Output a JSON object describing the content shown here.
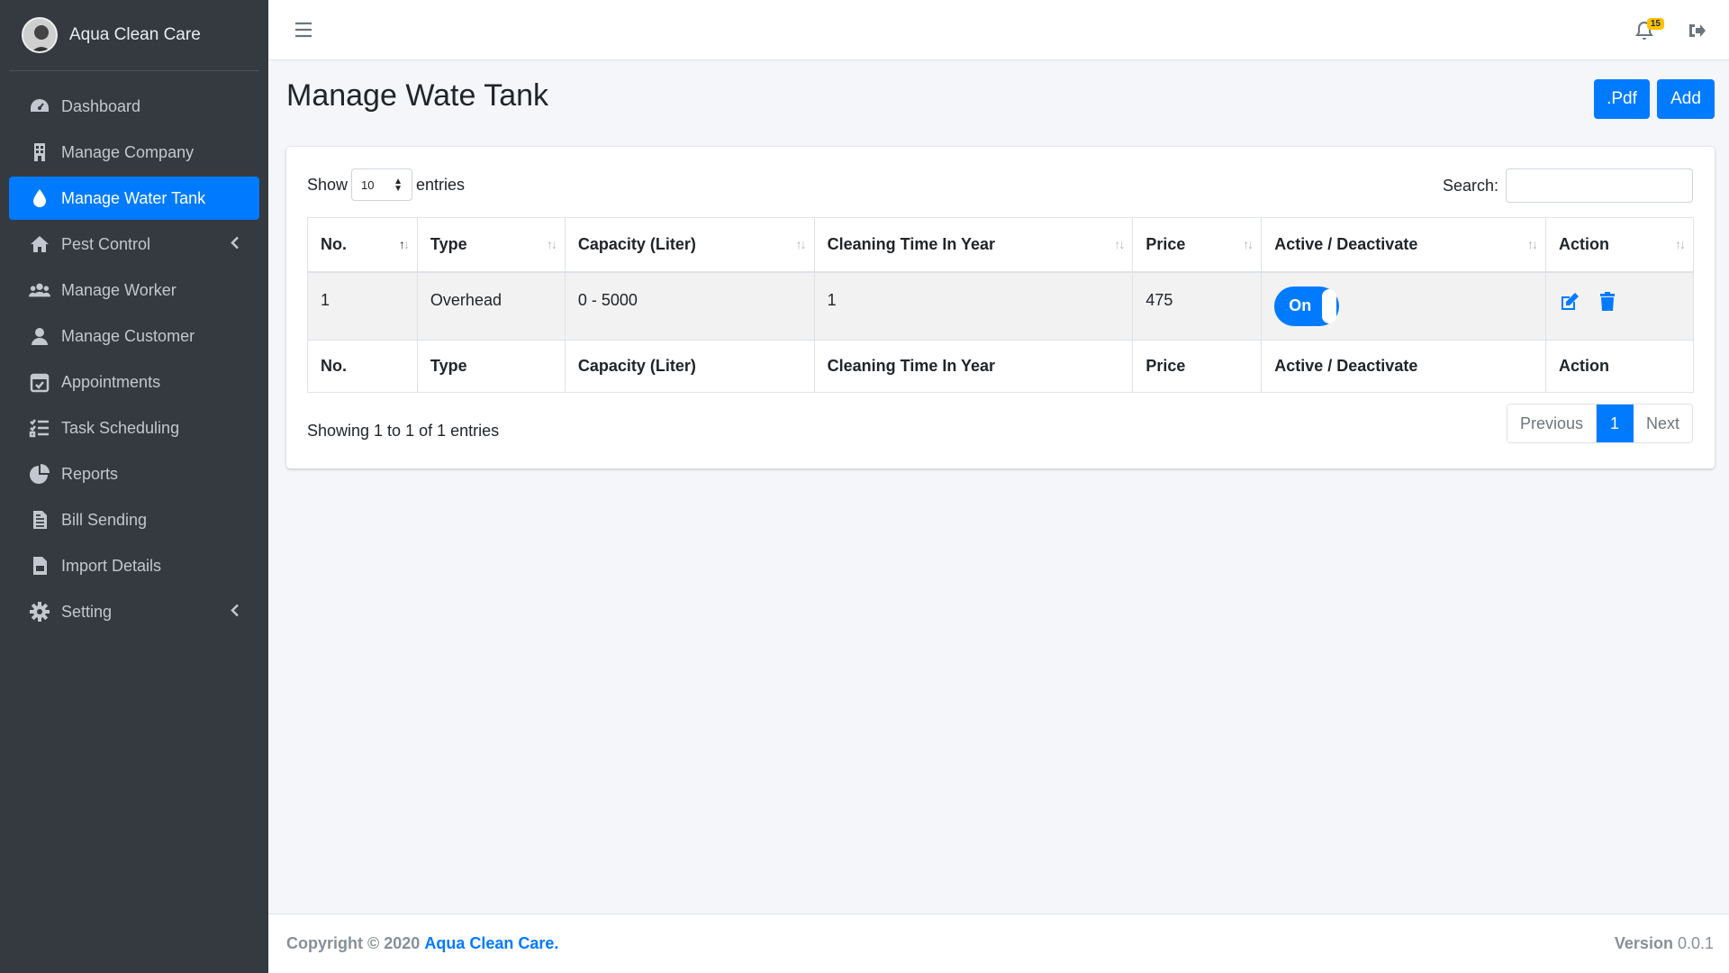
{
  "brand": {
    "name": "Aqua Clean Care"
  },
  "sidebar": {
    "items": [
      {
        "label": "Dashboard",
        "icon": "dashboard-icon"
      },
      {
        "label": "Manage Company",
        "icon": "building-icon"
      },
      {
        "label": "Manage Water Tank",
        "icon": "water-drop-icon",
        "active": true
      },
      {
        "label": "Pest Control",
        "icon": "home-icon",
        "expandable": true
      },
      {
        "label": "Manage Worker",
        "icon": "users-icon"
      },
      {
        "label": "Manage Customer",
        "icon": "user-icon"
      },
      {
        "label": "Appointments",
        "icon": "calendar-check-icon"
      },
      {
        "label": "Task Scheduling",
        "icon": "tasks-icon"
      },
      {
        "label": "Reports",
        "icon": "pie-chart-icon"
      },
      {
        "label": "Bill Sending",
        "icon": "file-invoice-icon"
      },
      {
        "label": "Import Details",
        "icon": "file-csv-icon"
      },
      {
        "label": "Setting",
        "icon": "gear-icon",
        "expandable": true
      }
    ]
  },
  "topbar": {
    "notification_count": "15"
  },
  "page": {
    "title": "Manage Wate Tank",
    "pdf_label": ".Pdf",
    "add_label": "Add"
  },
  "table_controls": {
    "show": "Show",
    "entries_value": "10",
    "entries": "entries",
    "search_label": "Search:",
    "search_value": ""
  },
  "table": {
    "columns": [
      "No.",
      "Type",
      "Capacity (Liter)",
      "Cleaning Time In Year",
      "Price",
      "Active / Deactivate",
      "Action"
    ],
    "rows": [
      {
        "no": "1",
        "type": "Overhead",
        "capacity": "0 - 5000",
        "cleaning": "1",
        "price": "475",
        "toggle": "On"
      }
    ]
  },
  "pagination": {
    "info": "Showing 1 to 1 of 1 entries",
    "previous": "Previous",
    "current": "1",
    "next": "Next"
  },
  "footer": {
    "copyright": "Copyright © 2020",
    "company": "Aqua Clean Care.",
    "version_label": "Version",
    "version": "0.0.1"
  },
  "colors": {
    "accent": "#007bff",
    "sidebar": "#343a40",
    "badge": "#ffc107"
  }
}
